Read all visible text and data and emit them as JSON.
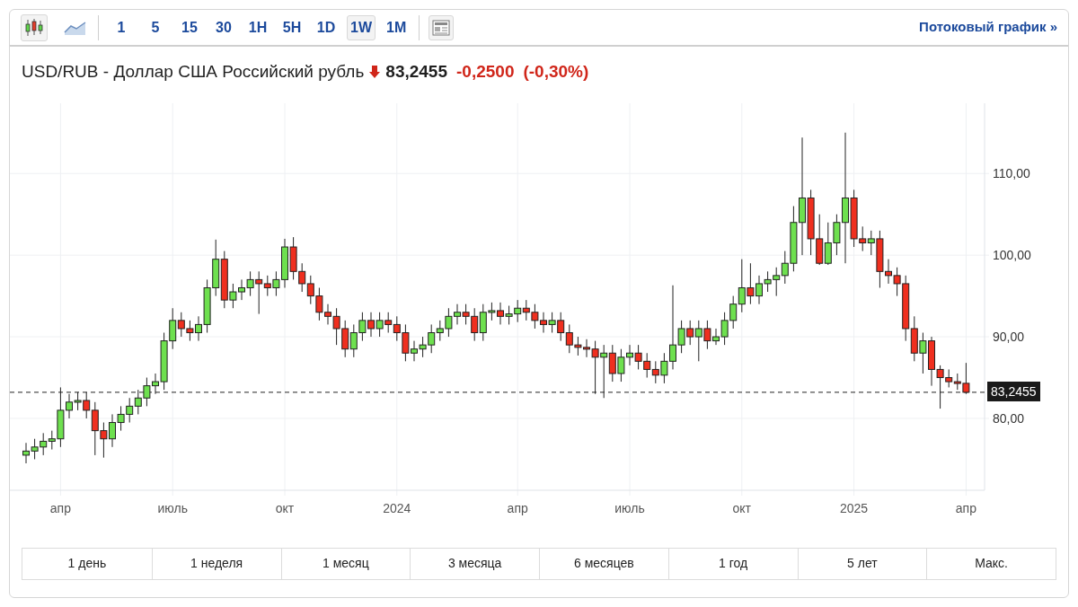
{
  "toolbar": {
    "chart_types": [
      {
        "kind": "candles",
        "selected": true
      },
      {
        "kind": "area",
        "selected": false
      }
    ],
    "intervals": [
      {
        "label": "1",
        "selected": false
      },
      {
        "label": "5",
        "selected": false
      },
      {
        "label": "15",
        "selected": false
      },
      {
        "label": "30",
        "selected": false
      },
      {
        "label": "1H",
        "selected": false
      },
      {
        "label": "5H",
        "selected": false
      },
      {
        "label": "1D",
        "selected": false
      },
      {
        "label": "1W",
        "selected": true
      },
      {
        "label": "1M",
        "selected": false
      }
    ],
    "streaming_link": "Потоковый график »"
  },
  "quote": {
    "name": "USD/RUB - Доллар США Российский рубль",
    "falling": true,
    "price": "83,2455",
    "change": "-0,2500",
    "change_percent": "(-0,30%)"
  },
  "chart": {
    "price_tag": "83,2455",
    "chart_data": {
      "type": "candlestick",
      "ylim": [
        71.2,
        118.6
      ],
      "grid": true,
      "ref_lines": [
        {
          "axis": "y",
          "value": 83.2
        }
      ],
      "categories": [
        null,
        null,
        null,
        null,
        "апр",
        null,
        null,
        null,
        null,
        null,
        null,
        null,
        null,
        null,
        null,
        null,
        null,
        "июль",
        null,
        null,
        null,
        null,
        null,
        null,
        null,
        null,
        null,
        null,
        null,
        null,
        "окт",
        null,
        null,
        null,
        null,
        null,
        null,
        null,
        null,
        null,
        null,
        null,
        null,
        "2024",
        null,
        null,
        null,
        null,
        null,
        null,
        null,
        null,
        null,
        null,
        null,
        null,
        null,
        "апр",
        null,
        null,
        null,
        null,
        null,
        null,
        null,
        null,
        null,
        null,
        null,
        null,
        "июль",
        null,
        null,
        null,
        null,
        null,
        null,
        null,
        null,
        null,
        null,
        null,
        null,
        "окт",
        null,
        null,
        null,
        null,
        null,
        null,
        null,
        null,
        null,
        null,
        null,
        null,
        "2025",
        null,
        null,
        null,
        null,
        null,
        null,
        null,
        null,
        null,
        null,
        null,
        null,
        "апр"
      ],
      "yticks": [
        {
          "value": 80,
          "label": "80,00"
        },
        {
          "value": 90,
          "label": "90,00"
        },
        {
          "value": 100,
          "label": "100,00"
        },
        {
          "value": 110,
          "label": "110,00"
        }
      ],
      "ohlc": [
        [
          75.5,
          77.0,
          74.5,
          76.0
        ],
        [
          76.0,
          77.5,
          75.0,
          76.5
        ],
        [
          76.5,
          78.2,
          75.5,
          77.2
        ],
        [
          77.2,
          78.5,
          76.2,
          77.5
        ],
        [
          77.5,
          83.8,
          76.5,
          81.0
        ],
        [
          81.0,
          83.0,
          80.0,
          82.0
        ],
        [
          82.0,
          83.2,
          81.0,
          82.2
        ],
        [
          82.2,
          83.2,
          80.0,
          81.0
        ],
        [
          81.0,
          82.0,
          75.5,
          78.5
        ],
        [
          78.5,
          79.5,
          75.2,
          77.5
        ],
        [
          77.5,
          80.5,
          76.5,
          79.5
        ],
        [
          79.5,
          81.5,
          78.5,
          80.5
        ],
        [
          80.5,
          82.5,
          79.5,
          81.5
        ],
        [
          81.5,
          83.5,
          80.5,
          82.5
        ],
        [
          82.5,
          85.0,
          81.5,
          84.0
        ],
        [
          84.0,
          85.5,
          83.0,
          84.5
        ],
        [
          84.5,
          90.5,
          83.5,
          89.5
        ],
        [
          89.5,
          93.5,
          88.5,
          92.0
        ],
        [
          92.0,
          93.0,
          90.0,
          91.0
        ],
        [
          91.0,
          92.0,
          89.5,
          90.5
        ],
        [
          90.5,
          92.5,
          89.5,
          91.5
        ],
        [
          91.5,
          97.0,
          90.5,
          96.0
        ],
        [
          96.0,
          101.9,
          95.0,
          99.5
        ],
        [
          99.5,
          100.5,
          93.5,
          94.5
        ],
        [
          94.5,
          96.5,
          93.5,
          95.5
        ],
        [
          95.5,
          97.0,
          94.5,
          96.0
        ],
        [
          96.0,
          98.0,
          95.0,
          97.0
        ],
        [
          97.0,
          98.0,
          92.8,
          96.5
        ],
        [
          96.5,
          97.5,
          95.0,
          96.0
        ],
        [
          96.0,
          98.0,
          95.0,
          97.0
        ],
        [
          97.0,
          102.0,
          96.0,
          101.0
        ],
        [
          101.0,
          102.2,
          97.0,
          98.0
        ],
        [
          98.0,
          99.0,
          95.5,
          96.5
        ],
        [
          96.5,
          97.5,
          94.0,
          95.0
        ],
        [
          95.0,
          96.0,
          92.0,
          93.0
        ],
        [
          93.0,
          94.0,
          91.5,
          92.5
        ],
        [
          92.5,
          93.5,
          89.0,
          91.0
        ],
        [
          91.0,
          92.0,
          87.5,
          88.5
        ],
        [
          88.5,
          91.5,
          87.5,
          90.5
        ],
        [
          90.5,
          93.0,
          89.5,
          92.0
        ],
        [
          92.0,
          93.0,
          90.0,
          91.0
        ],
        [
          91.0,
          93.0,
          90.0,
          92.0
        ],
        [
          92.0,
          93.0,
          90.5,
          91.5
        ],
        [
          91.5,
          92.5,
          89.5,
          90.5
        ],
        [
          90.5,
          91.5,
          87.0,
          88.0
        ],
        [
          88.0,
          89.5,
          87.0,
          88.5
        ],
        [
          88.5,
          90.0,
          87.5,
          89.0
        ],
        [
          89.0,
          91.5,
          88.0,
          90.5
        ],
        [
          90.5,
          92.0,
          89.5,
          91.0
        ],
        [
          91.0,
          93.5,
          90.0,
          92.5
        ],
        [
          92.5,
          94.0,
          91.5,
          93.0
        ],
        [
          93.0,
          94.0,
          91.5,
          92.5
        ],
        [
          92.5,
          93.5,
          89.5,
          90.5
        ],
        [
          90.5,
          94.0,
          89.5,
          93.0
        ],
        [
          93.0,
          94.2,
          92.0,
          93.2
        ],
        [
          93.2,
          94.2,
          91.5,
          92.5
        ],
        [
          92.5,
          93.8,
          91.5,
          92.8
        ],
        [
          92.8,
          94.5,
          91.8,
          93.5
        ],
        [
          93.5,
          94.5,
          92.0,
          93.0
        ],
        [
          93.0,
          94.0,
          91.0,
          92.0
        ],
        [
          92.0,
          93.0,
          90.5,
          91.5
        ],
        [
          91.5,
          93.0,
          90.5,
          92.0
        ],
        [
          92.0,
          93.0,
          89.5,
          90.5
        ],
        [
          90.5,
          91.5,
          88.0,
          89.0
        ],
        [
          89.0,
          90.0,
          87.7,
          88.7
        ],
        [
          88.7,
          89.7,
          87.5,
          88.5
        ],
        [
          88.5,
          89.5,
          83.0,
          87.5
        ],
        [
          87.5,
          89.0,
          82.5,
          88.0
        ],
        [
          88.0,
          89.0,
          84.5,
          85.5
        ],
        [
          85.5,
          88.5,
          84.5,
          87.5
        ],
        [
          87.5,
          89.0,
          86.5,
          88.0
        ],
        [
          88.0,
          89.0,
          86.0,
          87.0
        ],
        [
          87.0,
          88.0,
          85.0,
          86.0
        ],
        [
          86.0,
          87.0,
          84.3,
          85.3
        ],
        [
          85.3,
          88.0,
          84.3,
          87.0
        ],
        [
          87.0,
          96.3,
          86.0,
          89.0
        ],
        [
          89.0,
          92.0,
          88.0,
          91.0
        ],
        [
          91.0,
          92.0,
          89.0,
          90.0
        ],
        [
          90.0,
          92.0,
          87.0,
          91.0
        ],
        [
          91.0,
          92.0,
          88.5,
          89.5
        ],
        [
          89.5,
          91.0,
          89.0,
          90.0
        ],
        [
          90.0,
          93.0,
          89.0,
          92.0
        ],
        [
          92.0,
          95.0,
          91.0,
          94.0
        ],
        [
          94.0,
          99.5,
          93.0,
          96.0
        ],
        [
          96.0,
          99.0,
          94.0,
          95.0
        ],
        [
          95.0,
          97.5,
          94.0,
          96.5
        ],
        [
          96.5,
          98.0,
          95.5,
          97.0
        ],
        [
          97.0,
          98.5,
          95.0,
          97.5
        ],
        [
          97.5,
          100.5,
          96.5,
          99.0
        ],
        [
          99.0,
          106.0,
          98.0,
          104.0
        ],
        [
          104.0,
          114.4,
          100.0,
          107.0
        ],
        [
          107.0,
          108.0,
          100.0,
          102.0
        ],
        [
          102.0,
          105.0,
          98.8,
          99.0
        ],
        [
          99.0,
          104.0,
          98.8,
          101.5
        ],
        [
          101.5,
          105.0,
          100.0,
          104.0
        ],
        [
          104.0,
          115.0,
          99.0,
          107.0
        ],
        [
          107.0,
          108.0,
          101.0,
          102.0
        ],
        [
          102.0,
          103.5,
          100.5,
          101.5
        ],
        [
          101.5,
          103.0,
          100.0,
          102.0
        ],
        [
          102.0,
          103.0,
          96.0,
          98.0
        ],
        [
          98.0,
          99.5,
          96.5,
          97.5
        ],
        [
          97.5,
          98.5,
          95.0,
          96.5
        ],
        [
          96.5,
          97.5,
          89.5,
          91.0
        ],
        [
          91.0,
          92.5,
          87.0,
          88.0
        ],
        [
          88.0,
          90.5,
          85.5,
          89.5
        ],
        [
          89.5,
          90.0,
          84.0,
          86.0
        ],
        [
          86.0,
          86.5,
          81.2,
          85.0
        ],
        [
          85.0,
          86.0,
          83.8,
          84.5
        ],
        [
          84.5,
          85.5,
          83.5,
          84.3
        ],
        [
          84.3,
          86.8,
          83.0,
          83.2
        ]
      ]
    }
  },
  "ranges": [
    {
      "label": "1 день"
    },
    {
      "label": "1 неделя"
    },
    {
      "label": "1 месяц"
    },
    {
      "label": "3 месяца"
    },
    {
      "label": "6 месяцев"
    },
    {
      "label": "1 год"
    },
    {
      "label": "5 лет"
    },
    {
      "label": "Макс."
    }
  ]
}
